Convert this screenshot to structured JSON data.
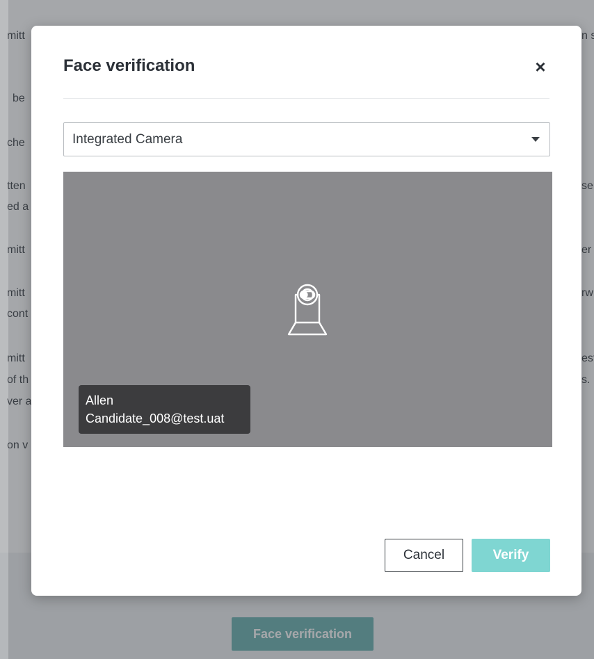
{
  "background": {
    "fragments_left": [
      "mitt",
      "be",
      "che",
      "tten",
      "ed a",
      "mitt",
      "mitt",
      "cont",
      "mitt",
      "of th",
      "ver a",
      "on v"
    ],
    "fragments_right": [
      "n s",
      "sen",
      "er",
      "rw",
      "est",
      "s. I"
    ],
    "footer_button_label": "Face verification"
  },
  "modal": {
    "title": "Face verification",
    "close_symbol": "×",
    "camera_select": {
      "selected": "Integrated Camera"
    },
    "video": {
      "icon": "camera-off-icon",
      "candidate_name": "Allen",
      "candidate_email": "Candidate_008@test.uat"
    },
    "cancel_label": "Cancel",
    "verify_label": "Verify"
  }
}
